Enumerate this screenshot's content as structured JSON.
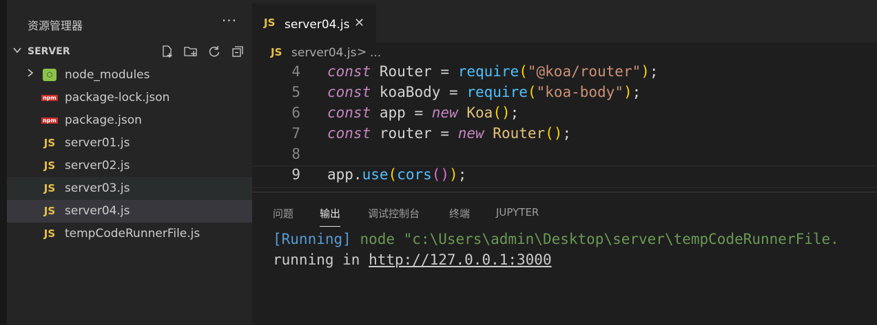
{
  "explorer": {
    "title": "资源管理器",
    "more": "···",
    "section": "SERVER",
    "section_actions": [
      "new-file-icon",
      "new-folder-icon",
      "refresh-icon",
      "collapse-icon"
    ]
  },
  "files": [
    {
      "name": "node_modules",
      "icon": "node-folder-icon",
      "folder": true
    },
    {
      "name": "package-lock.json",
      "icon": "npm-icon"
    },
    {
      "name": "package.json",
      "icon": "npm-icon"
    },
    {
      "name": "server01.js",
      "icon": "js-icon"
    },
    {
      "name": "server02.js",
      "icon": "js-icon"
    },
    {
      "name": "server03.js",
      "icon": "js-icon"
    },
    {
      "name": "server04.js",
      "icon": "js-icon"
    },
    {
      "name": "tempCodeRunnerFile.js",
      "icon": "js-icon"
    }
  ],
  "icon_labels": {
    "js": "JS",
    "npm": "npm"
  },
  "tab": {
    "name": "server04.js",
    "close": "✕"
  },
  "breadcrumb": {
    "file": "server04.js",
    "sep": ">",
    "ellipsis": "..."
  },
  "code": {
    "line_numbers": [
      "4",
      "5",
      "6",
      "7",
      "8",
      "9"
    ],
    "tokens": {
      "const": "const",
      "router_var": "Router",
      "eq": "=",
      "require": "require",
      "str1": "\"@koa/router\"",
      "semi": ";",
      "koaBody": "koaBody",
      "str2": "\"koa-body\"",
      "app": "app",
      "new": "new",
      "Koa": "Koa",
      "router": "router",
      "Router": "Router",
      "app_dot": "app.",
      "use": "use",
      "cors": "cors",
      "lparen": "(",
      "rparen": ")",
      "empty": "()"
    }
  },
  "panel": {
    "tabs": [
      "问题",
      "输出",
      "调试控制台",
      "终端",
      "JUPYTER"
    ],
    "active_tab": "输出",
    "output": {
      "running_tag": "[Running]",
      "command": " node \"c:\\Users\\admin\\Desktop\\server\\tempCodeRunnerFile.",
      "line2_prefix": "running in ",
      "url": "http://127.0.0.1:3000"
    }
  },
  "colors": {
    "js_icon": "#e8c04a",
    "keyword": "#c586c0",
    "string": "#ce9178",
    "accent_bracket": "#ffd700"
  }
}
